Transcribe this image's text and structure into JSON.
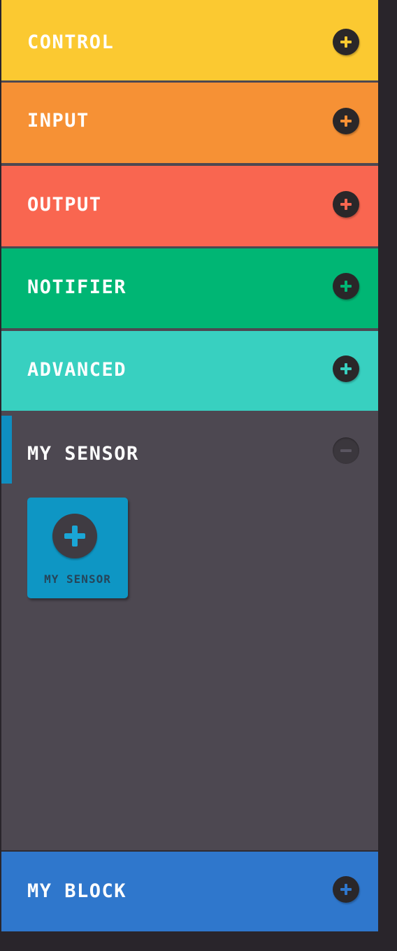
{
  "categories": [
    {
      "label": "CONTROL",
      "color": "#fbc931",
      "icon": "plus-icon"
    },
    {
      "label": "INPUT",
      "color": "#f69135",
      "icon": "plus-icon"
    },
    {
      "label": "OUTPUT",
      "color": "#f96650",
      "icon": "plus-icon"
    },
    {
      "label": "NOTIFIER",
      "color": "#00b674",
      "icon": "plus-icon"
    },
    {
      "label": "ADVANCED",
      "color": "#38d0c0",
      "icon": "plus-icon"
    }
  ],
  "my_sensor": {
    "label": "MY SENSOR",
    "accent_color": "#0f8ec0",
    "icon": "minus-icon",
    "tile": {
      "label": "MY SENSOR",
      "color": "#0e96c4",
      "icon": "plus-icon"
    }
  },
  "my_block": {
    "label": "MY BLOCK",
    "color": "#2f77cc",
    "icon": "plus-icon"
  }
}
